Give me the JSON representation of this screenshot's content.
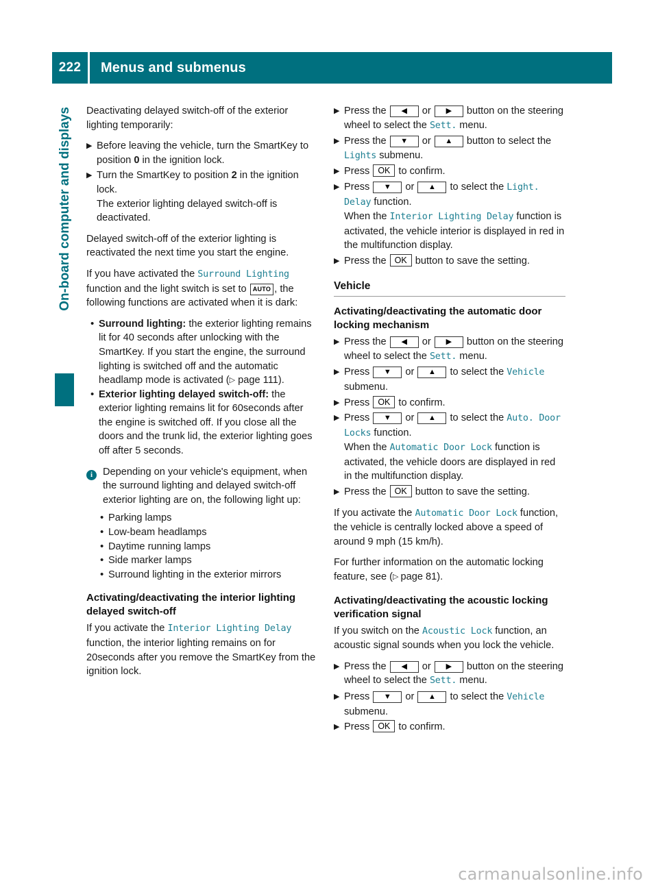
{
  "header": {
    "page_number": "222",
    "title": "Menus and submenus",
    "bar_color": "#00707f"
  },
  "side_tab": {
    "label": "On-board computer and displays",
    "color": "#00707f"
  },
  "icons": {
    "left_arrow": "◀",
    "right_arrow": "▶",
    "down_arrow": "▼",
    "up_arrow": "▲",
    "ok": "OK",
    "auto": "AUTO",
    "info": "i",
    "step_marker": "▶",
    "bullet_dot": "•",
    "page_ref_arrow": "▷"
  },
  "left_column": {
    "intro": "Deactivating delayed switch-off of the exterior lighting temporarily:",
    "steps": [
      {
        "parts": [
          {
            "t": "text",
            "v": "Before leaving the vehicle, turn the SmartKey to position "
          },
          {
            "t": "bold",
            "v": "0"
          },
          {
            "t": "text",
            "v": " in the ignition lock."
          }
        ]
      },
      {
        "parts": [
          {
            "t": "text",
            "v": "Turn the SmartKey to position "
          },
          {
            "t": "bold",
            "v": "2"
          },
          {
            "t": "text",
            "v": " in the ignition lock."
          },
          {
            "t": "break"
          },
          {
            "t": "text",
            "v": "The exterior lighting delayed switch-off is deactivated."
          }
        ]
      }
    ],
    "para_reactivated": "Delayed switch-off of the exterior lighting is reactivated the next time you start the engine.",
    "para_surround": {
      "p1": "If you have activated the ",
      "ui1": "Surround Lighting",
      "p2": " function and the light switch is set to ",
      "key_auto": "AUTO",
      "p3": ", the following functions are activated when it is dark:"
    },
    "feature_bullets": [
      {
        "bold_lead": "Surround lighting:",
        "text": " the exterior lighting remains lit for 40 seconds after unlocking with the SmartKey. If you start the engine, the surround lighting is switched off and the automatic headlamp mode is activated",
        "page_ref": "page 111"
      },
      {
        "bold_lead": "Exterior lighting delayed switch-off:",
        "text": " the exterior lighting remains lit for 60seconds after the engine is switched off. If you close all the doors and the trunk lid, the exterior lighting goes off after 5 seconds.",
        "page_ref": ""
      }
    ],
    "note": "Depending on your vehicle's equipment, when the surround lighting and delayed switch-off exterior lighting are on, the following light up:",
    "note_bullets": [
      "Parking lamps",
      "Low-beam headlamps",
      "Daytime running lamps",
      "Side marker lamps",
      "Surround lighting in the exterior mirrors"
    ],
    "heading_interior": "Activating/deactivating the interior lighting delayed switch-off",
    "para_interior": {
      "p1": "If you activate the ",
      "ui1": "Interior Lighting Delay",
      "p2": " function, the interior lighting remains on for 20seconds after you remove the SmartKey from the ignition lock."
    }
  },
  "right_column": {
    "lights_steps": [
      {
        "parts": [
          {
            "t": "text",
            "v": "Press the "
          },
          {
            "t": "key",
            "v": "◀"
          },
          {
            "t": "text",
            "v": " or "
          },
          {
            "t": "key",
            "v": "▶"
          },
          {
            "t": "text",
            "v": " button on the steering wheel to select the "
          },
          {
            "t": "ui",
            "v": "Sett."
          },
          {
            "t": "text",
            "v": " menu."
          }
        ]
      },
      {
        "parts": [
          {
            "t": "text",
            "v": "Press the "
          },
          {
            "t": "key",
            "v": "▼"
          },
          {
            "t": "text",
            "v": " or "
          },
          {
            "t": "key",
            "v": "▲"
          },
          {
            "t": "text",
            "v": " button to select the "
          },
          {
            "t": "ui",
            "v": "Lights"
          },
          {
            "t": "text",
            "v": " submenu."
          }
        ]
      },
      {
        "parts": [
          {
            "t": "text",
            "v": "Press "
          },
          {
            "t": "keyok",
            "v": "OK"
          },
          {
            "t": "text",
            "v": " to confirm."
          }
        ]
      },
      {
        "parts": [
          {
            "t": "text",
            "v": "Press "
          },
          {
            "t": "key",
            "v": "▼"
          },
          {
            "t": "text",
            "v": " or "
          },
          {
            "t": "key",
            "v": "▲"
          },
          {
            "t": "text",
            "v": " to select the "
          },
          {
            "t": "ui",
            "v": "Light. Delay"
          },
          {
            "t": "text",
            "v": " function."
          },
          {
            "t": "break"
          },
          {
            "t": "text",
            "v": "When the "
          },
          {
            "t": "ui",
            "v": "Interior Lighting Delay"
          },
          {
            "t": "text",
            "v": " function is activated, the vehicle interior is displayed in red in the multifunction display."
          }
        ]
      },
      {
        "parts": [
          {
            "t": "text",
            "v": "Press the "
          },
          {
            "t": "keyok",
            "v": "OK"
          },
          {
            "t": "text",
            "v": " button to save the setting."
          }
        ]
      }
    ],
    "section_vehicle": "Vehicle",
    "heading_door_lock": "Activating/deactivating the automatic door locking mechanism",
    "door_lock_steps": [
      {
        "parts": [
          {
            "t": "text",
            "v": "Press the "
          },
          {
            "t": "key",
            "v": "◀"
          },
          {
            "t": "text",
            "v": " or "
          },
          {
            "t": "key",
            "v": "▶"
          },
          {
            "t": "text",
            "v": " button on the steering wheel to select the "
          },
          {
            "t": "ui",
            "v": "Sett."
          },
          {
            "t": "text",
            "v": " menu."
          }
        ]
      },
      {
        "parts": [
          {
            "t": "text",
            "v": "Press "
          },
          {
            "t": "key",
            "v": "▼"
          },
          {
            "t": "text",
            "v": " or "
          },
          {
            "t": "key",
            "v": "▲"
          },
          {
            "t": "text",
            "v": " to select the "
          },
          {
            "t": "ui",
            "v": "Vehicle"
          },
          {
            "t": "text",
            "v": " submenu."
          }
        ]
      },
      {
        "parts": [
          {
            "t": "text",
            "v": "Press "
          },
          {
            "t": "keyok",
            "v": "OK"
          },
          {
            "t": "text",
            "v": " to confirm."
          }
        ]
      },
      {
        "parts": [
          {
            "t": "text",
            "v": "Press "
          },
          {
            "t": "key",
            "v": "▼"
          },
          {
            "t": "text",
            "v": " or "
          },
          {
            "t": "key",
            "v": "▲"
          },
          {
            "t": "text",
            "v": " to select the "
          },
          {
            "t": "ui",
            "v": "Auto. Door Locks"
          },
          {
            "t": "text",
            "v": " function."
          },
          {
            "t": "break"
          },
          {
            "t": "text",
            "v": "When the "
          },
          {
            "t": "ui",
            "v": "Automatic Door Lock"
          },
          {
            "t": "text",
            "v": " function is activated, the vehicle doors are displayed in red in the multifunction display."
          }
        ]
      },
      {
        "parts": [
          {
            "t": "text",
            "v": "Press the "
          },
          {
            "t": "keyok",
            "v": "OK"
          },
          {
            "t": "text",
            "v": " button to save the setting."
          }
        ]
      }
    ],
    "para_auto_lock": {
      "p1": "If you activate the ",
      "ui1": "Automatic Door Lock",
      "p2": " function, the vehicle is centrally locked above a speed of around 9 mph (15 km/h)."
    },
    "para_further_info": {
      "p1": "For further information on the automatic locking feature, see (",
      "page_ref": "page 81",
      "p2": ")."
    },
    "heading_acoustic": "Activating/deactivating the acoustic locking verification signal",
    "para_acoustic": {
      "p1": "If you switch on the ",
      "ui1": "Acoustic Lock",
      "p2": " function, an acoustic signal sounds when you lock the vehicle."
    },
    "acoustic_steps": [
      {
        "parts": [
          {
            "t": "text",
            "v": "Press the "
          },
          {
            "t": "key",
            "v": "◀"
          },
          {
            "t": "text",
            "v": " or "
          },
          {
            "t": "key",
            "v": "▶"
          },
          {
            "t": "text",
            "v": " button on the steering wheel to select the "
          },
          {
            "t": "ui",
            "v": "Sett."
          },
          {
            "t": "text",
            "v": " menu."
          }
        ]
      },
      {
        "parts": [
          {
            "t": "text",
            "v": "Press "
          },
          {
            "t": "key",
            "v": "▼"
          },
          {
            "t": "text",
            "v": " or "
          },
          {
            "t": "key",
            "v": "▲"
          },
          {
            "t": "text",
            "v": " to select the "
          },
          {
            "t": "ui",
            "v": "Vehicle"
          },
          {
            "t": "text",
            "v": " submenu."
          }
        ]
      },
      {
        "parts": [
          {
            "t": "text",
            "v": "Press "
          },
          {
            "t": "keyok",
            "v": "OK"
          },
          {
            "t": "text",
            "v": " to confirm."
          }
        ]
      }
    ]
  },
  "watermark": "carmanualsonline.info"
}
